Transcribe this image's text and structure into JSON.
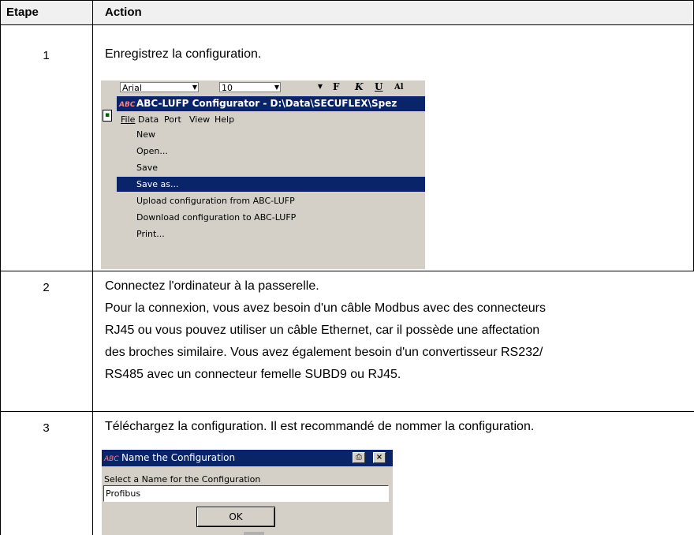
{
  "table": {
    "headers": {
      "step": "Etape",
      "action": "Action"
    },
    "rows": [
      {
        "step": "1",
        "text": [
          "Enregistrez la configuration."
        ]
      },
      {
        "step": "2",
        "text": [
          "Connectez l'ordinateur à la passerelle.",
          "Pour la connexion, vous avez besoin d'un câble Modbus avec des connecteurs",
          "RJ45 ou vous pouvez utiliser un câble Ethernet, car il possède une affectation",
          "des broches similaire. Vous avez également besoin d'un convertisseur RS232/",
          "RS485 avec un connecteur femelle SUBD9 ou RJ45."
        ]
      },
      {
        "step": "3",
        "text": [
          "Téléchargez la configuration. Il est recommandé de nommer la configuration."
        ]
      }
    ]
  },
  "screenshot1": {
    "toolbar": {
      "font": "Arial",
      "size": "10",
      "bold": "F",
      "italic": "K",
      "underline": "U",
      "fragment": "Al"
    },
    "app_icon": "ABC",
    "window_title": "ABC-LUFP Configurator - D:\\Data\\SECUFLEX\\Spez",
    "menubar": [
      "File",
      "Data",
      "Port",
      "View",
      "Help"
    ],
    "menu_items": [
      "New",
      "Open...",
      "Save",
      "Save as...",
      "Upload configuration from ABC-LUFP",
      "Download configuration to ABC-LUFP",
      "Print..."
    ],
    "selected_item": "Save as..."
  },
  "screenshot2": {
    "app_icon": "ABC",
    "title": "Name the Configuration",
    "label": "Select a Name for the Configuration",
    "input_value": "Profibus",
    "ok_label": "OK",
    "close_glyph": "×",
    "print_glyph": "⎙"
  },
  "colors": {
    "title_bar": "#0a246a",
    "menu_bg": "#d4d0c8",
    "header_bg": "#f0f0f0"
  }
}
